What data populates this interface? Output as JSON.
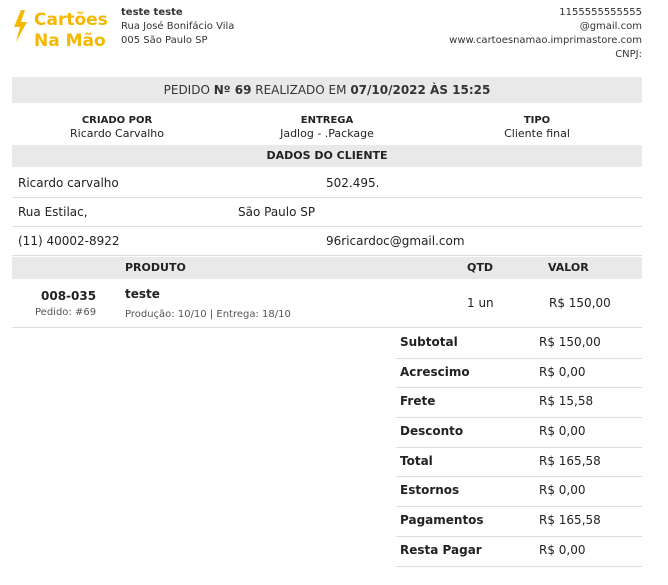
{
  "logo": {
    "line1": "Cartões",
    "line2": "Na Mão"
  },
  "company": {
    "name": "teste teste",
    "address1": "Rua José Bonifácio Vila",
    "address2": "005 São Paulo SP"
  },
  "contact": {
    "phone": "1155555555555",
    "email": "@gmail.com",
    "website": "www.cartoesnamao.imprimastore.com",
    "cnpj": "CNPJ:"
  },
  "order": {
    "prefix": "PEDIDO",
    "number_label": "Nº 69",
    "middle": "REALIZADO EM",
    "date": "07/10/2022 ÀS 15:25"
  },
  "meta": {
    "created_by_label": "CRIADO POR",
    "created_by": "Ricardo Carvalho",
    "delivery_label": "ENTREGA",
    "delivery": "Jadlog - .Package",
    "type_label": "TIPO",
    "type": "Cliente final"
  },
  "client": {
    "section_title": "DADOS DO CLIENTE",
    "name": "Ricardo carvalho",
    "document": "502.495.",
    "street": "Rua Estilac,",
    "city": "São Paulo SP",
    "phone": "(11) 40002-8922",
    "email": "96ricardoc@gmail.com"
  },
  "products": {
    "headers": {
      "product": "PRODUTO",
      "qty": "QTD",
      "value": "VALOR"
    },
    "items": [
      {
        "code": "008-035",
        "order_ref": "Pedido: #69",
        "name": "teste",
        "details": "Produção: 10/10 | Entrega: 18/10",
        "qty": "1 un",
        "value": "R$ 150,00"
      }
    ]
  },
  "totals": [
    {
      "label": "Subtotal",
      "value": "R$ 150,00"
    },
    {
      "label": "Acrescimo",
      "value": "R$ 0,00"
    },
    {
      "label": "Frete",
      "value": "R$ 15,58"
    },
    {
      "label": "Desconto",
      "value": "R$ 0,00"
    },
    {
      "label": "Total",
      "value": "R$ 165,58"
    },
    {
      "label": "Estornos",
      "value": "R$ 0,00"
    },
    {
      "label": "Pagamentos",
      "value": "R$ 165,58"
    },
    {
      "label": "Resta Pagar",
      "value": "R$ 0,00"
    }
  ],
  "colors": {
    "brand": "#f5b800",
    "band": "#e9e9e9",
    "divider": "#dcdcdc"
  }
}
